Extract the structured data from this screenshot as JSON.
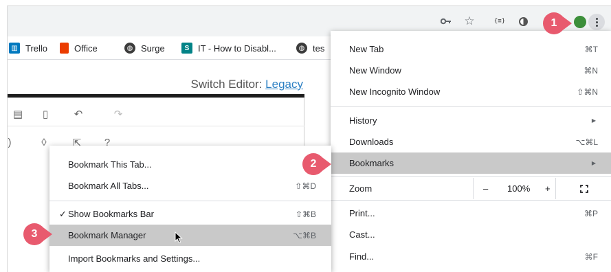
{
  "toolbar": {
    "icons": [
      "key-icon",
      "star-icon",
      "json-extension-icon",
      "circle-extension-icon",
      "profile-avatar",
      "menu-icon"
    ],
    "json_ext_label": "{≡}"
  },
  "bookmarks_bar": {
    "items": [
      {
        "label": "Trello",
        "icon": "trello-icon"
      },
      {
        "label": "Office",
        "icon": "office-icon"
      },
      {
        "label": "Surge",
        "icon": "globe-icon"
      },
      {
        "label": "IT - How to Disabl...",
        "icon": "sharepoint-icon"
      },
      {
        "label": "tes",
        "icon": "globe-icon"
      }
    ]
  },
  "page": {
    "switch_editor_label": "Switch Editor:",
    "switch_editor_link": "Legacy"
  },
  "main_menu": {
    "new_tab": {
      "label": "New Tab",
      "shortcut": "⌘T"
    },
    "new_window": {
      "label": "New Window",
      "shortcut": "⌘N"
    },
    "new_incognito": {
      "label": "New Incognito Window",
      "shortcut": "⇧⌘N"
    },
    "history": {
      "label": "History"
    },
    "downloads": {
      "label": "Downloads",
      "shortcut": "⌥⌘L"
    },
    "bookmarks": {
      "label": "Bookmarks"
    },
    "zoom": {
      "label": "Zoom",
      "minus": "–",
      "level": "100%",
      "plus": "+"
    },
    "print": {
      "label": "Print...",
      "shortcut": "⌘P"
    },
    "cast": {
      "label": "Cast..."
    },
    "find": {
      "label": "Find...",
      "shortcut": "⌘F"
    }
  },
  "bookmarks_submenu": {
    "bookmark_this_tab": {
      "label": "Bookmark This Tab..."
    },
    "bookmark_all_tabs": {
      "label": "Bookmark All Tabs...",
      "shortcut": "⇧⌘D"
    },
    "show_bookmarks_bar": {
      "label": "Show Bookmarks Bar",
      "shortcut": "⇧⌘B",
      "checked": true,
      "check": "✓"
    },
    "bookmark_manager": {
      "label": "Bookmark Manager",
      "shortcut": "⌥⌘B"
    },
    "import": {
      "label": "Import Bookmarks and Settings..."
    }
  },
  "callouts": {
    "step1": "1",
    "step2": "2",
    "step3": "3",
    "color": "#e85a6e"
  }
}
